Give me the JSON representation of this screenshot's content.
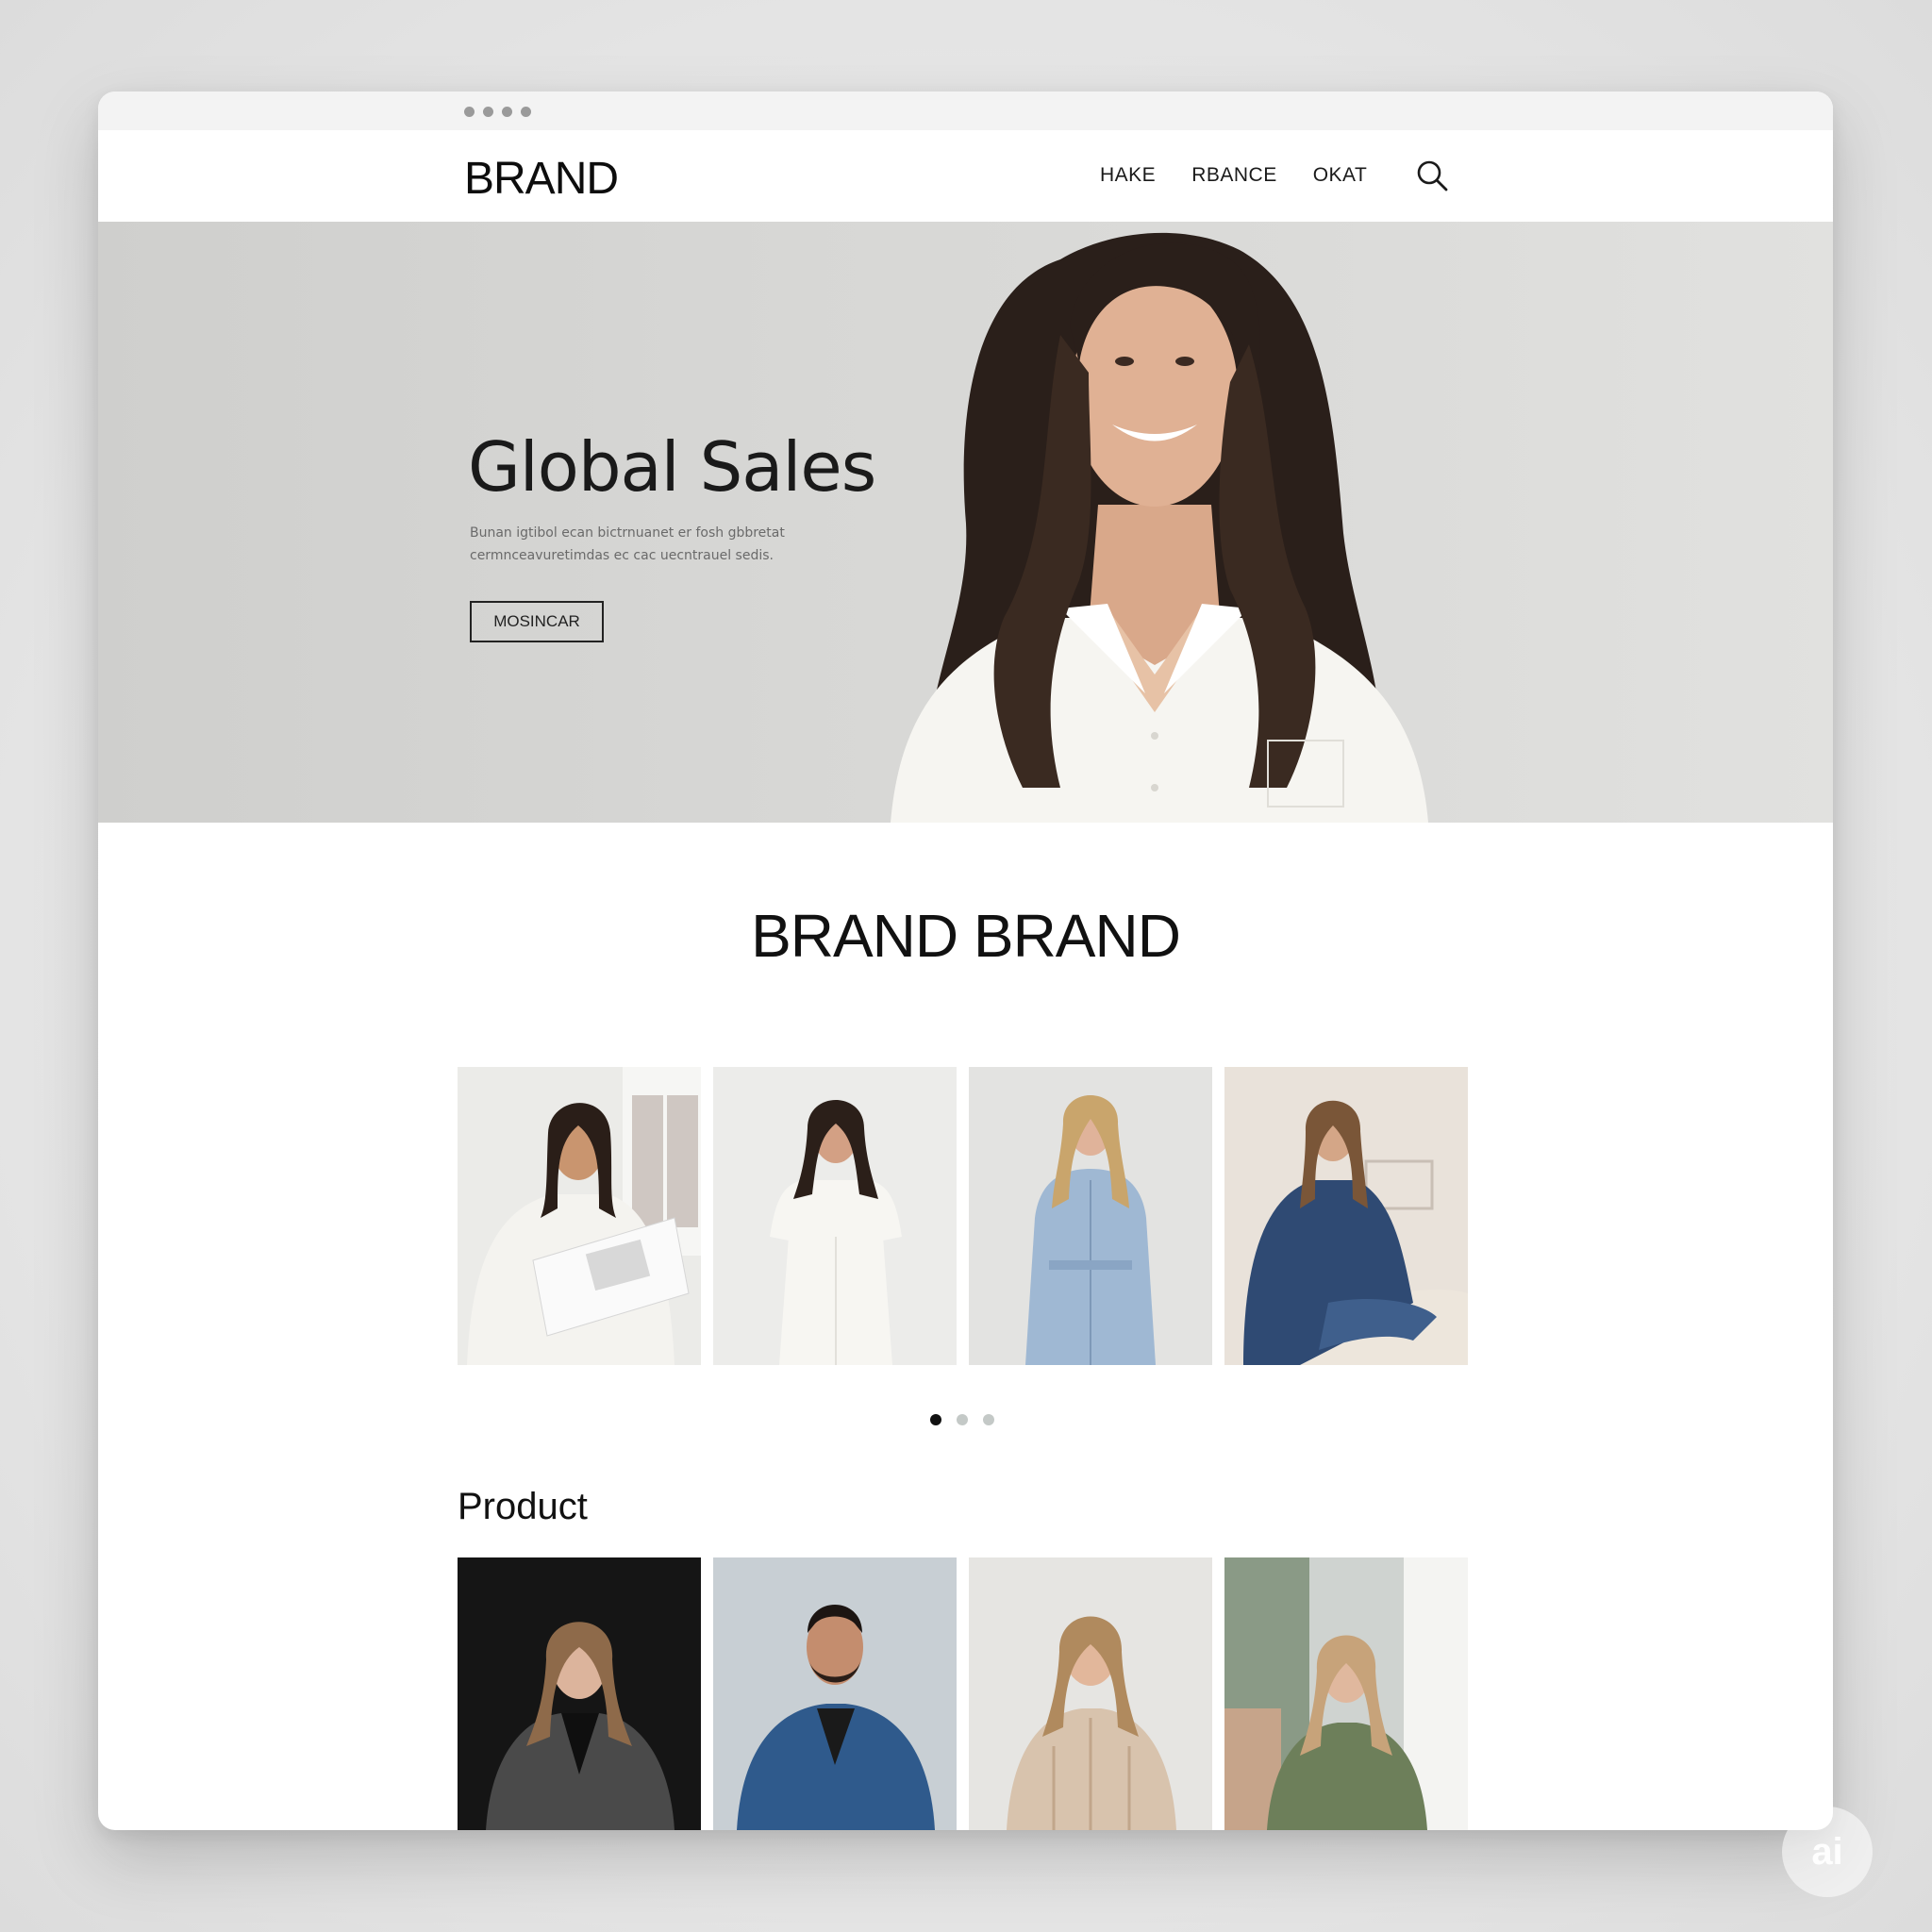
{
  "header": {
    "logo": "BRAND",
    "nav": [
      "HAKE",
      "RBANCE",
      "OKAT"
    ],
    "search_icon": "search-icon"
  },
  "hero": {
    "title": "Global Sales",
    "subtitle": "Bunan igtibol ecan bictrnuanet er fosh gbbretat cermnceavuretimdas ec cac uecntrauel sedis.",
    "cta": "MOSINCAR"
  },
  "collection": {
    "title": "BRAND BRAND",
    "pager": {
      "count": 3,
      "active": 0
    }
  },
  "product": {
    "heading": "Product"
  },
  "watermark": "ai",
  "colors": {
    "page_bg": "#e6e6e6",
    "hero_bg": "#d7d7d5",
    "text": "#111111",
    "pager_inactive": "#c4c9c7"
  }
}
